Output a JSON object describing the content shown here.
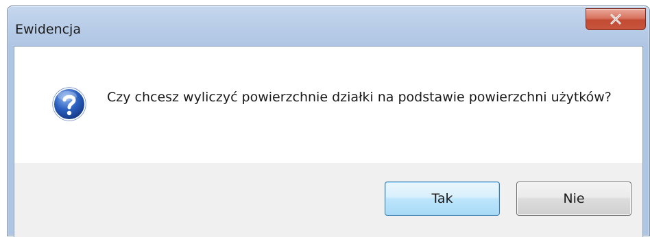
{
  "window": {
    "title": "Ewidencja"
  },
  "dialog": {
    "icon": "question-icon",
    "message": "Czy chcesz wyliczyć powierzchnie działki na podstawie powierzchni użytków?",
    "buttons": {
      "yes_label": "Tak",
      "no_label": "Nie"
    }
  },
  "colors": {
    "close_button": "#c7553d",
    "icon_blue": "#1e4fa8",
    "default_button_border": "#3c7fb1"
  }
}
